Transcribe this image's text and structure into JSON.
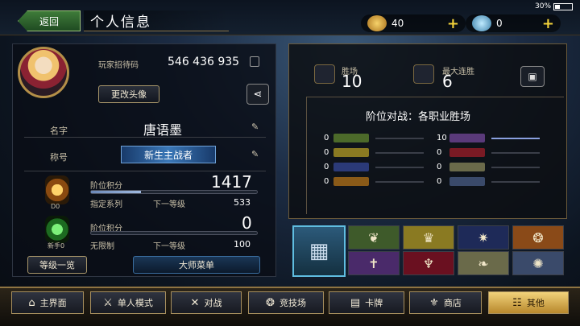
{
  "status": {
    "battery": "30%",
    "battery_level": 0.3
  },
  "header": {
    "back_label": "返回",
    "title": "个人信息"
  },
  "resources": [
    {
      "icon": "gold-coin-icon",
      "value": "40"
    },
    {
      "icon": "crystal-icon",
      "value": "0"
    }
  ],
  "profile": {
    "invite_label": "玩家招待码",
    "invite_code": "546 436 935",
    "change_avatar": "更改头像",
    "name_label": "名字",
    "name": "唐语墨",
    "title_label": "称号",
    "title_value": "新生主战者",
    "ranked": {
      "label": "阶位积分",
      "points": "1417",
      "series_label": "指定系列",
      "next_label": "下一等级",
      "next_value": "533",
      "rank_badge": "D0",
      "progress": 0.3
    },
    "unlimited": {
      "label": "阶位积分",
      "points": "0",
      "series_label": "无限制",
      "next_label": "下一等级",
      "next_value": "100",
      "rank_badge": "新手0",
      "progress": 0
    },
    "level_list": "等级一览",
    "master_menu": "大师菜单"
  },
  "stats": {
    "wins_label": "胜场",
    "wins": "10",
    "streak_label": "最大连胜",
    "streak": "6",
    "section_title": "阶位对战：各职业胜场",
    "class_wins": [
      {
        "value": "0",
        "color": "#4c6a2a",
        "side": "left"
      },
      {
        "value": "0",
        "color": "#8a7a22",
        "side": "left"
      },
      {
        "value": "0",
        "color": "#2b3a78",
        "side": "left"
      },
      {
        "value": "0",
        "color": "#8a5a18",
        "side": "left"
      },
      {
        "value": "10",
        "color": "#5a3a7a",
        "side": "right",
        "level": 1.0
      },
      {
        "value": "0",
        "color": "#7a1a24",
        "side": "right"
      },
      {
        "value": "0",
        "color": "#6a6a4a",
        "side": "right"
      },
      {
        "value": "0",
        "color": "#3a4a6a",
        "side": "right"
      }
    ]
  },
  "class_grid": [
    {
      "icon": "leaf-icon",
      "color": "#3e5a2a",
      "glyph": "❦"
    },
    {
      "icon": "crown-icon",
      "color": "#8a7a22",
      "glyph": "♛"
    },
    {
      "icon": "star-sigil-icon",
      "color": "#1e2a58",
      "glyph": "✷"
    },
    {
      "icon": "dragon-icon",
      "color": "#8a4a18",
      "glyph": "❂"
    },
    {
      "icon": "tombstone-icon",
      "color": "#4a2a6a",
      "glyph": "✝"
    },
    {
      "icon": "bat-icon",
      "color": "#6a1020",
      "glyph": "♆"
    },
    {
      "icon": "wings-icon",
      "color": "#6a6a4a",
      "glyph": "❧"
    },
    {
      "icon": "swirl-icon",
      "color": "#3a4a6a",
      "glyph": "✺"
    }
  ],
  "nav": [
    {
      "label": "主界面",
      "icon": "home-icon",
      "glyph": "⌂"
    },
    {
      "label": "单人模式",
      "icon": "sword-icon",
      "glyph": "⚔"
    },
    {
      "label": "对战",
      "icon": "crossed-swords-icon",
      "glyph": "✕"
    },
    {
      "label": "竞技场",
      "icon": "arena-icon",
      "glyph": "❂"
    },
    {
      "label": "卡牌",
      "icon": "cards-icon",
      "glyph": "▤"
    },
    {
      "label": "商店",
      "icon": "shop-icon",
      "glyph": "⚜"
    },
    {
      "label": "其他",
      "icon": "menu-icon",
      "glyph": "☷"
    }
  ]
}
